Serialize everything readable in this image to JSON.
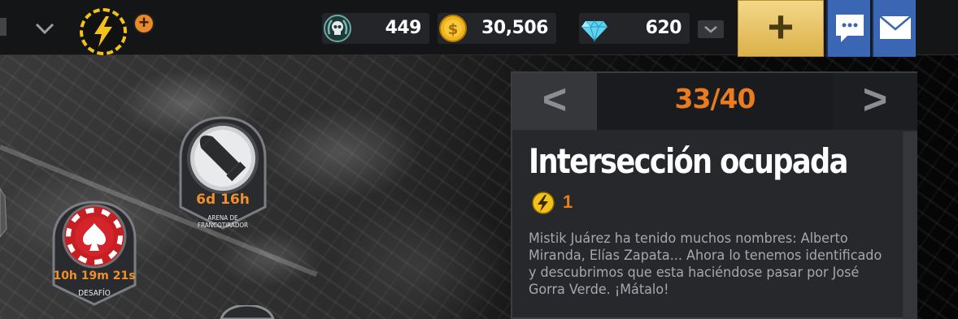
{
  "resources": {
    "skulls": "449",
    "coins": "30,506",
    "gems": "620"
  },
  "pager": {
    "prev": "<",
    "count": "33/40",
    "next": ">"
  },
  "mission": {
    "title": "Intersección ocupada",
    "energy_cost": "1",
    "description": "Mistik Juárez ha tenido muchos nombres: Alberto Miranda, Elías Zapata... Ahora lo tenemos identificado y descubrimos que esta haciéndose pasar por José Gorra Verde. ¡Mátalo!"
  },
  "markers": {
    "sniper": {
      "timer": "6d 16h",
      "label": "ARENA DE\nFRANCOTIRADOR"
    },
    "challenge": {
      "timer": "10h 19m 21s",
      "label": "DESAFÍO"
    }
  },
  "colors": {
    "accent_orange": "#e87c1e",
    "energy_yellow": "#f2c21b",
    "buy_gold": "#dcb04a",
    "social_blue": "#3a66b3",
    "challenge_red": "#d2242a"
  },
  "icons": {
    "energy": "lightning-bolt-icon",
    "skulls": "skull-laurel-icon",
    "coins": "dollar-coin-icon",
    "gems": "diamond-icon",
    "buy": "plus-icon",
    "chat": "chat-bubble-icon",
    "mail": "envelope-icon"
  }
}
